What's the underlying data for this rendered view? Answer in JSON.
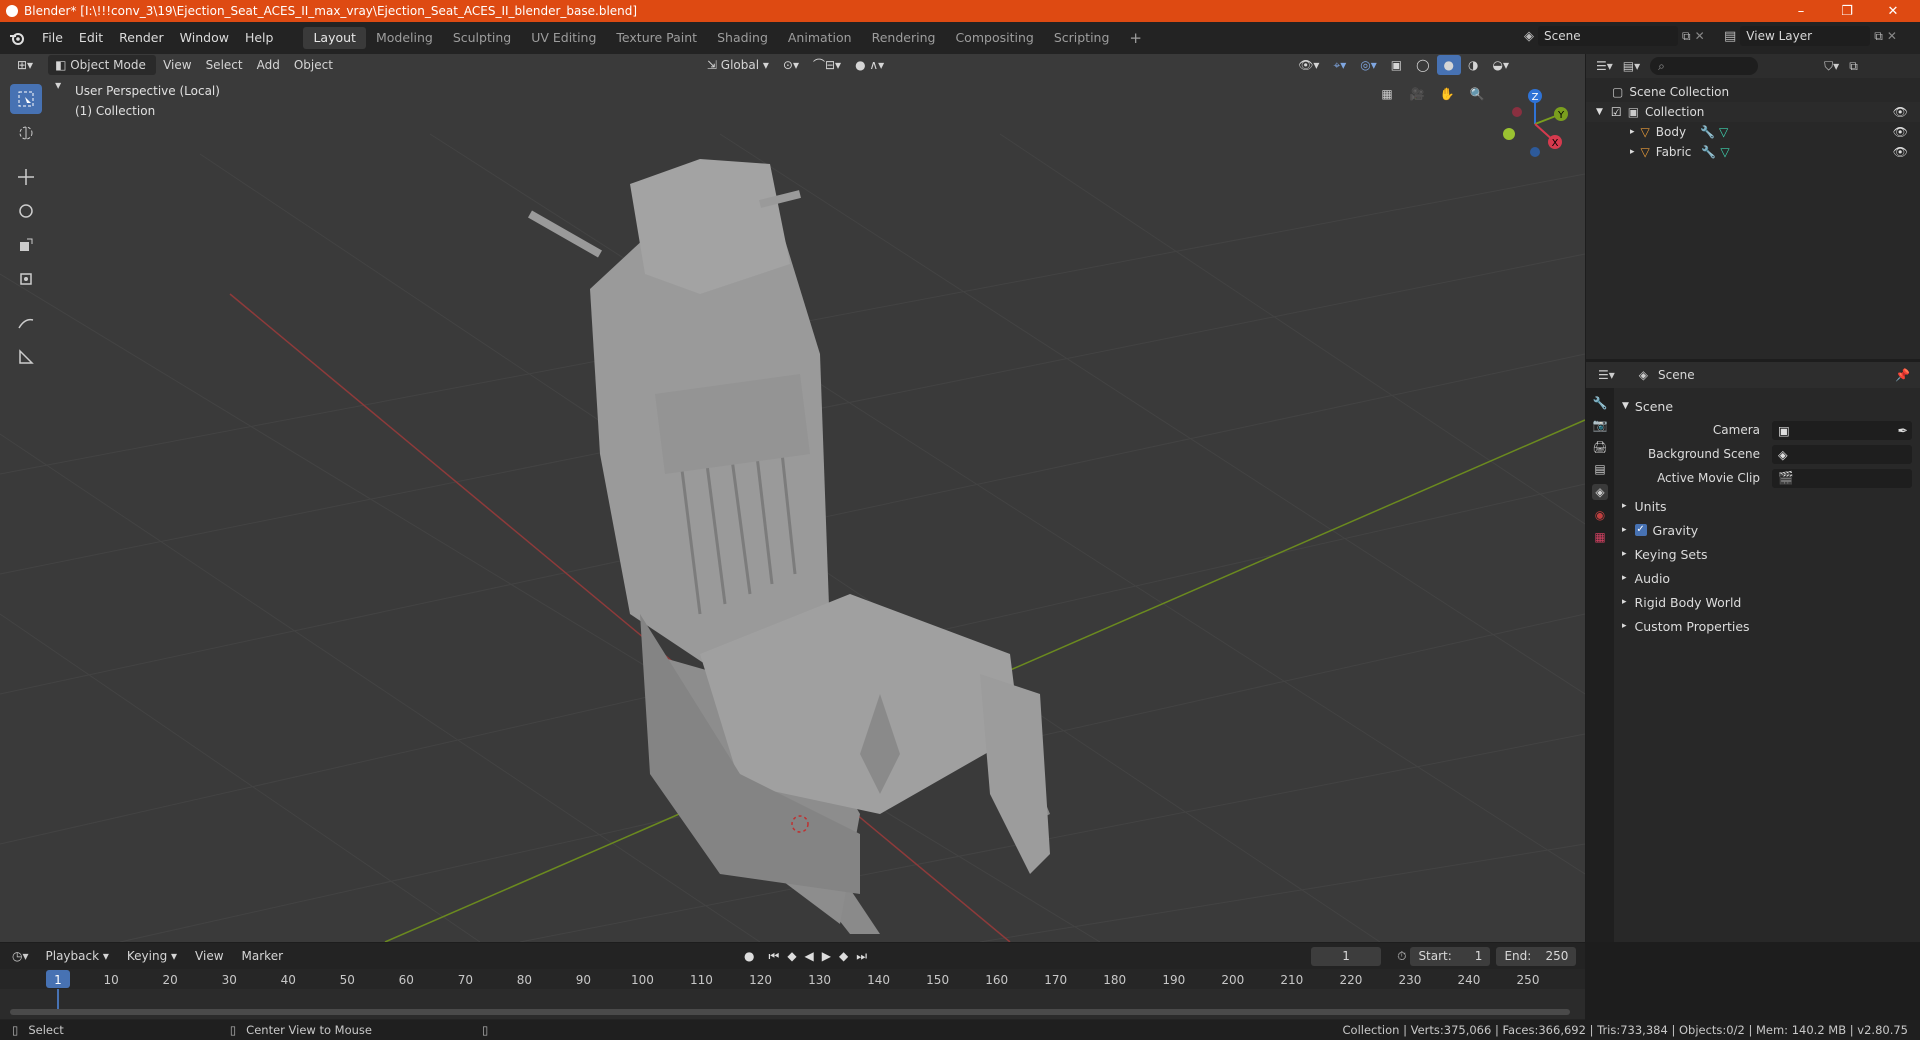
{
  "window": {
    "title": "Blender* [I:\\!!!conv_3\\19\\Ejection_Seat_ACES_II_max_vray\\Ejection_Seat_ACES_II_blender_base.blend]",
    "controls": [
      "–",
      "❐",
      "✕"
    ]
  },
  "menu": {
    "items": [
      "File",
      "Edit",
      "Render",
      "Window",
      "Help"
    ],
    "workspaces": [
      "Layout",
      "Modeling",
      "Sculpting",
      "UV Editing",
      "Texture Paint",
      "Shading",
      "Animation",
      "Rendering",
      "Compositing",
      "Scripting"
    ],
    "active_workspace": "Layout",
    "add_tab": "+",
    "scene_name": "Scene",
    "view_layer": "View Layer"
  },
  "viewport": {
    "mode": "Object Mode",
    "menus": [
      "View",
      "Select",
      "Add",
      "Object"
    ],
    "transform_orientation": "Global",
    "overlay_title": "User Perspective (Local)",
    "overlay_subtitle": "(1) Collection",
    "gizmo_axes": {
      "x": "X",
      "y": "Y",
      "z": "Z"
    },
    "colors": {
      "background": "#3a3a3a",
      "grid": "#444444",
      "x_axis": "#9b3b3b",
      "y_axis": "#6b8f23",
      "accent": "#4772b3"
    }
  },
  "outliner": {
    "search_placeholder": "",
    "root": "Scene Collection",
    "collection": "Collection",
    "objects": [
      {
        "name": "Body"
      },
      {
        "name": "Fabric"
      }
    ]
  },
  "properties": {
    "context": "Scene",
    "section": "Scene",
    "fields": [
      {
        "label": "Camera",
        "value": ""
      },
      {
        "label": "Background Scene",
        "value": ""
      },
      {
        "label": "Active Movie Clip",
        "value": ""
      }
    ],
    "panels": [
      "Units",
      "Gravity",
      "Keying Sets",
      "Audio",
      "Rigid Body World",
      "Custom Properties"
    ],
    "gravity_checked": true
  },
  "timeline": {
    "menus": [
      "Playback",
      "Keying",
      "View",
      "Marker"
    ],
    "current_frame": "1",
    "start_label": "Start:",
    "start": "1",
    "end_label": "End:",
    "end": "250",
    "ticks": [
      "1",
      "10",
      "20",
      "30",
      "40",
      "50",
      "60",
      "70",
      "80",
      "90",
      "100",
      "110",
      "120",
      "130",
      "140",
      "150",
      "160",
      "170",
      "180",
      "190",
      "200",
      "210",
      "220",
      "230",
      "240",
      "250"
    ]
  },
  "status": {
    "left_action": "Select",
    "middle_action": "Center View to Mouse",
    "stats": "Collection | Verts:375,066 | Faces:366,692 | Tris:733,384 | Objects:0/2 | Mem: 140.2 MB | v2.80.75"
  }
}
